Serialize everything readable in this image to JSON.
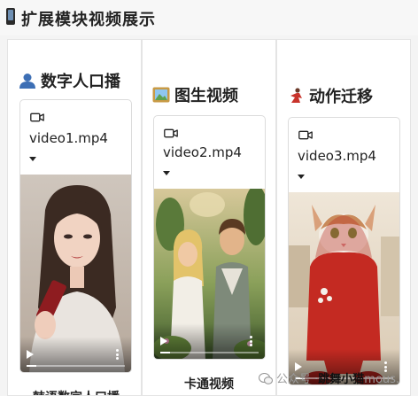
{
  "header": {
    "icon": "mobile-phone-icon",
    "title": "扩展模块视频展示"
  },
  "columns": [
    {
      "icon": "person-icon",
      "title": "数字人口播",
      "video": {
        "icon": "video-camera-icon",
        "filename": "video1.mp4",
        "progress": 0.1
      },
      "caption": "韩语数字人口播"
    },
    {
      "icon": "framed-picture-icon",
      "title": "图生视频",
      "video": {
        "icon": "video-camera-icon",
        "filename": "video2.mp4",
        "progress": 0.1
      },
      "caption": "卡通视频"
    },
    {
      "icon": "dancer-icon",
      "title": "动作迁移",
      "video": {
        "icon": "video-camera-icon",
        "filename": "video3.mp4",
        "progress": 0.1
      },
      "caption": ""
    }
  ],
  "watermark": {
    "icon": "wechat-icon",
    "prefix": "公众号 ·",
    "name": "跳舞小猫",
    "suffix": "mous."
  },
  "colors": {
    "accent": "#6e8fb3",
    "panel_border": "#e4e4e4",
    "page_bg": "#f4f4f4"
  }
}
